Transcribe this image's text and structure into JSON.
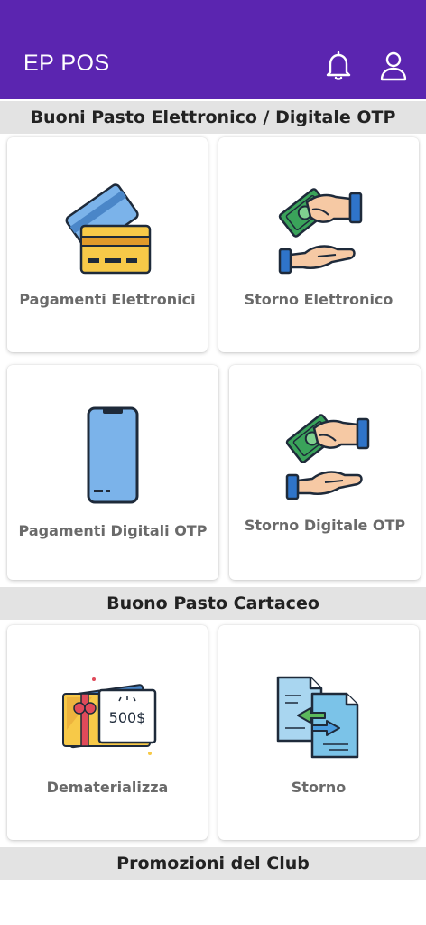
{
  "app_title": "EP POS",
  "header_icons": [
    "bell-icon",
    "user-icon"
  ],
  "colors": {
    "appbar": "#5b25b0",
    "section_bg": "#e3e3e3",
    "card_label": "#6a6a6a"
  },
  "sections": {
    "electronic": "Buoni Pasto Elettronico / Digitale OTP",
    "paper": "Buono Pasto Cartaceo",
    "club": "Promozioni del Club"
  },
  "cards": {
    "pagamenti_elettronici": {
      "label": "Pagamenti Elettronici",
      "icon": "credit-card-icon"
    },
    "storno_elettronico": {
      "label": "Storno Elettronico",
      "icon": "money-refund-icon"
    },
    "pagamenti_digitali": {
      "label": "Pagamenti Digitali OTP",
      "icon": "smartphone-icon"
    },
    "storno_digitale": {
      "label": "Storno Digitale OTP",
      "icon": "money-refund-icon"
    },
    "dematerializza": {
      "label": "Dematerializza",
      "icon": "voucher-icon",
      "voucher_value": "500$"
    },
    "storno": {
      "label": "Storno",
      "icon": "document-exchange-icon"
    }
  }
}
